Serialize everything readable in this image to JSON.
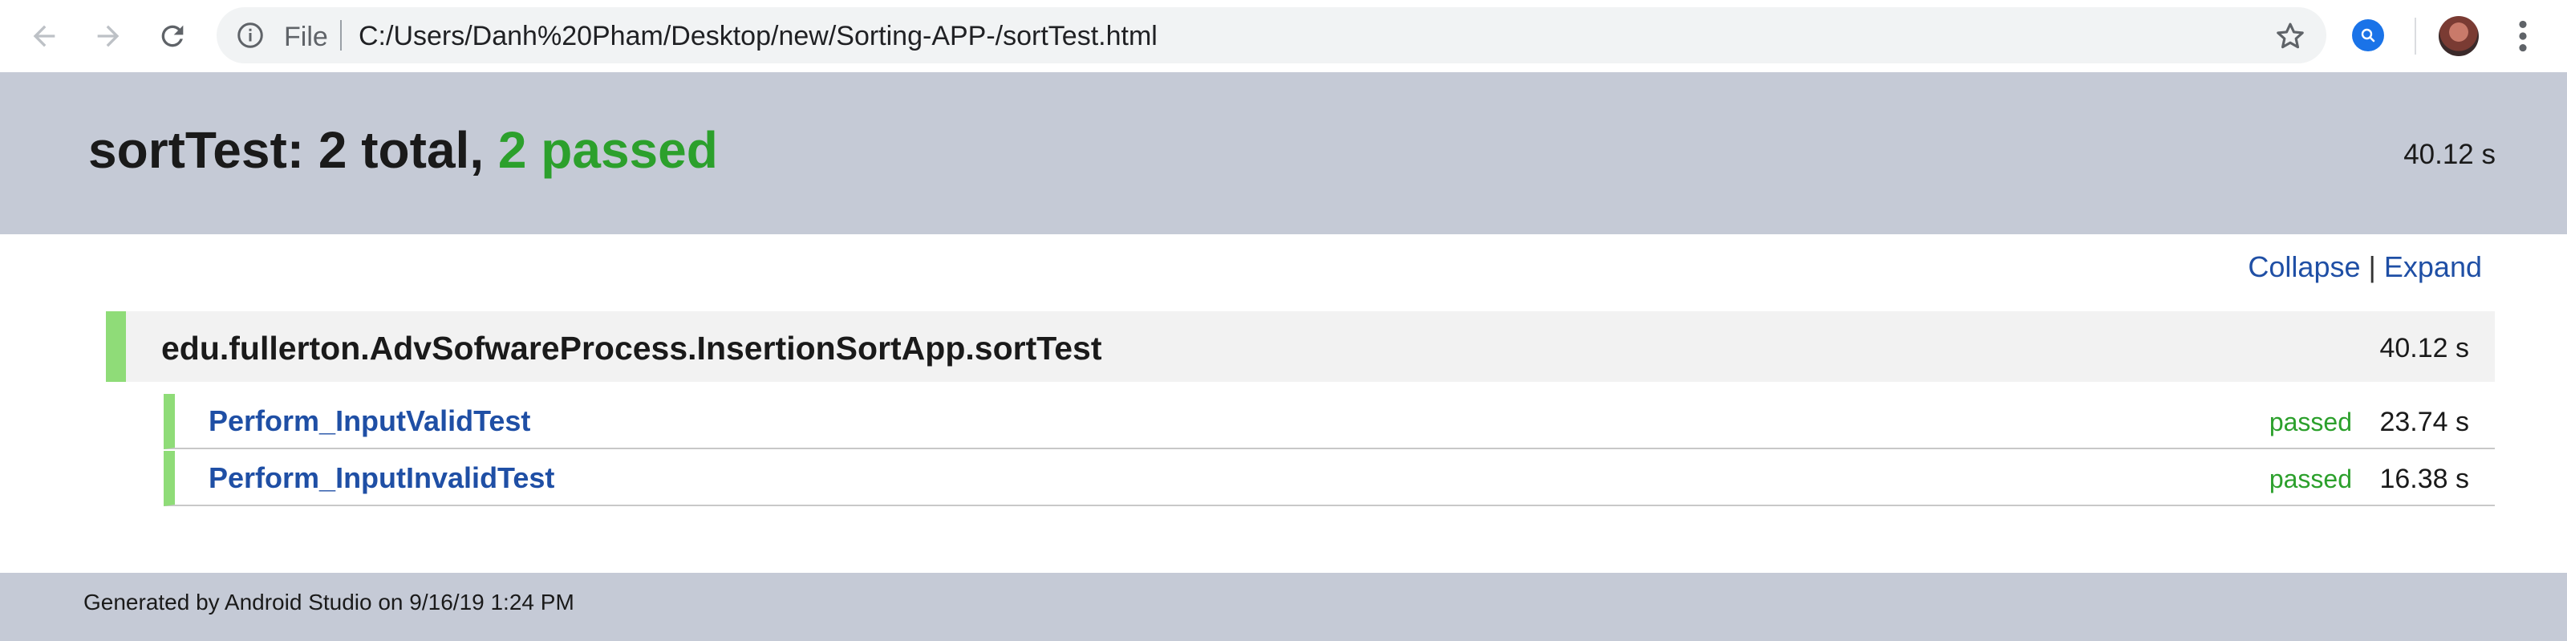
{
  "browser": {
    "address_scheme": "File",
    "address_url": "C:/Users/Danh%20Pham/Desktop/new/Sorting-APP-/sortTest.html",
    "icons": [
      "back-arrow-icon",
      "forward-arrow-icon",
      "reload-icon",
      "info-icon",
      "star-icon",
      "extension-icon",
      "avatar",
      "menu-dots-icon"
    ]
  },
  "report": {
    "title_prefix": "sortTest: 2 total,",
    "title_passed": "2 passed",
    "total_duration": "40.12 s",
    "collapse_label": "Collapse",
    "link_separator": "|",
    "expand_label": "Expand",
    "suite": {
      "name": "edu.fullerton.AdvSofwareProcess.InsertionSortApp.sortTest",
      "duration": "40.12 s"
    },
    "tests": [
      {
        "name": "Perform_InputValidTest",
        "status": "passed",
        "duration": "23.74 s"
      },
      {
        "name": "Perform_InputInvalidTest",
        "status": "passed",
        "duration": "16.38 s"
      }
    ],
    "footer": "Generated by Android Studio on 9/16/19 1:24 PM"
  },
  "colors": {
    "header_band": "#c5cad6",
    "pass_green": "#2ca02c",
    "pass_bar": "#8fdc78",
    "link_blue": "#1f4fa5"
  }
}
